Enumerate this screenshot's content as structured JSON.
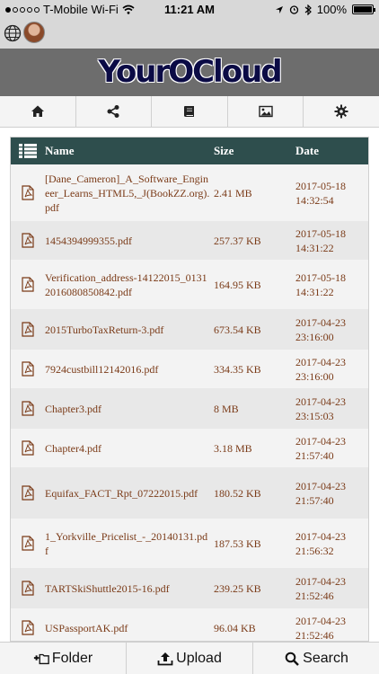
{
  "status_bar": {
    "carrier": "T-Mobile Wi-Fi",
    "time": "11:21 AM",
    "battery": "100%",
    "battery_level": 1.0,
    "signal_bars_filled": 1,
    "signal_bars_total": 5
  },
  "user_bar": {
    "globe_icon": "globe-icon",
    "avatar": "user-avatar"
  },
  "header": {
    "logo": "YourOCloud",
    "logo_color": "#0b0b45",
    "band_color": "#6d6d6d"
  },
  "nav": {
    "items": [
      {
        "name": "home",
        "icon": "home-icon"
      },
      {
        "name": "share",
        "icon": "share-icon"
      },
      {
        "name": "book",
        "icon": "book-icon"
      },
      {
        "name": "image",
        "icon": "image-icon"
      },
      {
        "name": "settings",
        "icon": "gear-icon"
      }
    ]
  },
  "table": {
    "header_color": "#2e4e4d",
    "columns": {
      "icon": "list-icon",
      "name": "Name",
      "size": "Size",
      "date": "Date"
    },
    "rows": [
      {
        "name": "[Dane_Cameron]_A_Software_Engineer_Learns_HTML5,_J(BookZZ.org).pdf",
        "size": "2.41 MB",
        "date": "2017-05-18 14:32:54"
      },
      {
        "name": "1454394999355.pdf",
        "size": "257.37 KB",
        "date": "2017-05-18 14:31:22"
      },
      {
        "name": "Verification_address-14122015_01312016080850842.pdf",
        "size": "164.95 KB",
        "date": "2017-05-18 14:31:22"
      },
      {
        "name": "2015TurboTaxReturn-3.pdf",
        "size": "673.54 KB",
        "date": "2017-04-23 23:16:00"
      },
      {
        "name": "7924custbill12142016.pdf",
        "size": "334.35 KB",
        "date": "2017-04-23 23:16:00"
      },
      {
        "name": "Chapter3.pdf",
        "size": "8 MB",
        "date": "2017-04-23 23:15:03"
      },
      {
        "name": "Chapter4.pdf",
        "size": "3.18 MB",
        "date": "2017-04-23 21:57:40"
      },
      {
        "name": "Equifax_FACT_Rpt_07222015.pdf",
        "size": "180.52 KB",
        "date": "2017-04-23 21:57:40"
      },
      {
        "name": "1_Yorkville_Pricelist_-_20140131.pdf",
        "size": "187.53 KB",
        "date": "2017-04-23 21:56:32"
      },
      {
        "name": "TARTSkiShuttle2015-16.pdf",
        "size": "239.25 KB",
        "date": "2017-04-23 21:52:46"
      },
      {
        "name": "USPassportAK.pdf",
        "size": "96.04 KB",
        "date": "2017-04-23 21:52:46"
      }
    ]
  },
  "bottom_bar": {
    "folder_label": "Folder",
    "upload_label": "Upload",
    "search_label": "Search"
  }
}
